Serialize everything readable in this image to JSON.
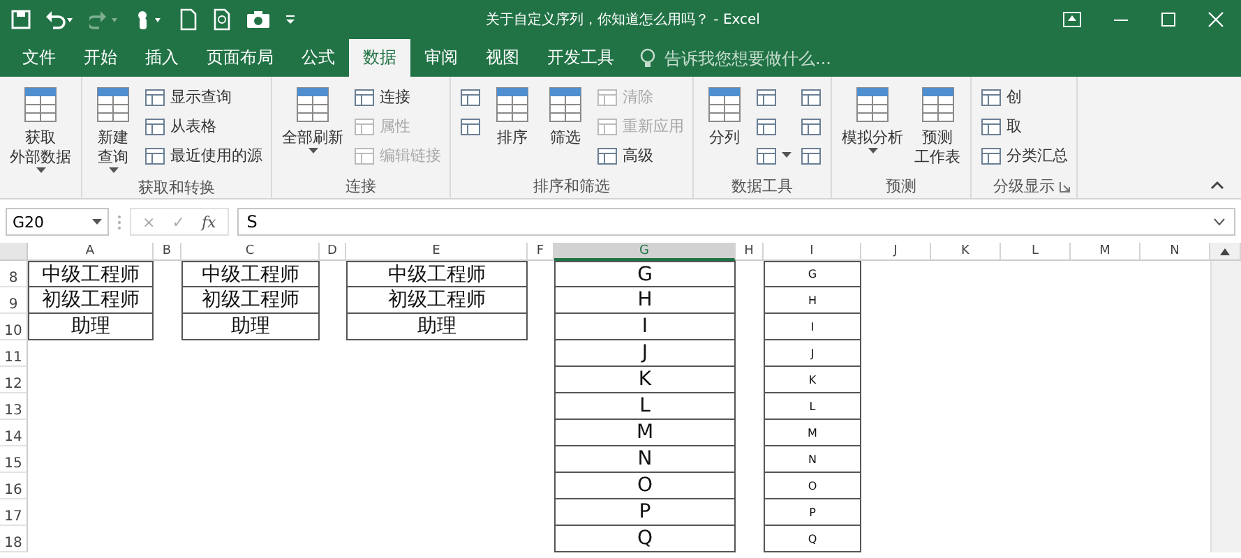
{
  "window": {
    "title": "关于自定义序列，你知道怎么用吗？ - Excel"
  },
  "tabs": [
    {
      "label": "文件",
      "selected": false
    },
    {
      "label": "开始",
      "selected": false
    },
    {
      "label": "插入",
      "selected": false
    },
    {
      "label": "页面布局",
      "selected": false
    },
    {
      "label": "公式",
      "selected": false
    },
    {
      "label": "数据",
      "selected": true
    },
    {
      "label": "审阅",
      "selected": false
    },
    {
      "label": "视图",
      "selected": false
    },
    {
      "label": "开发工具",
      "selected": false
    }
  ],
  "tell_me": {
    "placeholder": "告诉我您想要做什么..."
  },
  "ribbon": {
    "groups": [
      {
        "items": [
          {
            "kind": "large",
            "lines": [
              "获取",
              "外部数据"
            ],
            "dropdown": true
          }
        ]
      },
      {
        "label": "获取和转换",
        "items": [
          {
            "kind": "large",
            "lines": [
              "新建",
              "查询"
            ],
            "dropdown": true
          },
          {
            "kind": "small",
            "label": "显示查询",
            "disabled": false
          },
          {
            "kind": "small",
            "label": "从表格",
            "disabled": false
          },
          {
            "kind": "small",
            "label": "最近使用的源",
            "disabled": false
          }
        ]
      },
      {
        "label": "连接",
        "items": [
          {
            "kind": "large",
            "lines": [
              "全部刷新"
            ],
            "dropdown": true
          },
          {
            "kind": "small",
            "label": "连接",
            "disabled": false
          },
          {
            "kind": "small",
            "label": "属性",
            "disabled": true
          },
          {
            "kind": "small",
            "label": "编辑链接",
            "disabled": true
          }
        ]
      },
      {
        "label": "排序和筛选",
        "items": [
          {
            "kind": "icon"
          },
          {
            "kind": "icon"
          },
          {
            "kind": "large",
            "lines": [
              "排序"
            ]
          },
          {
            "kind": "large",
            "lines": [
              "筛选"
            ]
          },
          {
            "kind": "small",
            "label": "清除",
            "disabled": true
          },
          {
            "kind": "small",
            "label": "重新应用",
            "disabled": true
          },
          {
            "kind": "small",
            "label": "高级",
            "disabled": false
          }
        ]
      },
      {
        "label": "数据工具",
        "items": [
          {
            "kind": "large",
            "lines": [
              "分列"
            ]
          },
          {
            "kind": "icon"
          },
          {
            "kind": "icon"
          },
          {
            "kind": "icon",
            "dropdown": true
          },
          {
            "kind": "icon"
          },
          {
            "kind": "icon"
          },
          {
            "kind": "icon"
          }
        ]
      },
      {
        "label": "预测",
        "items": [
          {
            "kind": "large",
            "lines": [
              "模拟分析"
            ],
            "dropdown": true
          },
          {
            "kind": "large",
            "lines": [
              "预测",
              "工作表"
            ]
          }
        ]
      },
      {
        "label": "分级显示",
        "launcher": true,
        "items": [
          {
            "kind": "small",
            "label": "创",
            "disabled": false
          },
          {
            "kind": "small",
            "label": "取",
            "disabled": false
          },
          {
            "kind": "small",
            "label": "分类汇总",
            "disabled": false
          }
        ]
      }
    ]
  },
  "formula_bar": {
    "name_box": "G20",
    "buttons": [
      "×",
      "✓",
      "fx"
    ],
    "value": "S"
  },
  "sheet": {
    "row_numbers": [
      "8",
      "9",
      "10",
      "11",
      "12",
      "13",
      "14",
      "15",
      "16",
      "17",
      "18"
    ],
    "columns": [
      {
        "label": "A",
        "selected": false,
        "cells": [
          "中级工程师",
          "初级工程师",
          "助理"
        ]
      },
      {
        "label": "B",
        "selected": false
      },
      {
        "label": "C",
        "selected": false,
        "cells": [
          "中级工程师",
          "初级工程师",
          "助理"
        ]
      },
      {
        "label": "D",
        "selected": false
      },
      {
        "label": "E",
        "selected": false,
        "cells": [
          "中级工程师",
          "初级工程师",
          "助理"
        ]
      },
      {
        "label": "F",
        "selected": false
      },
      {
        "label": "G",
        "selected": true,
        "cells": [
          "G",
          "H",
          "I",
          "J",
          "K",
          "L",
          "M",
          "N",
          "O",
          "P",
          "Q"
        ]
      },
      {
        "label": "H",
        "selected": false
      },
      {
        "label": "I",
        "selected": false,
        "cells": [
          "G",
          "H",
          "I",
          "J",
          "K",
          "L",
          "M",
          "N",
          "O",
          "P",
          "Q"
        ]
      },
      {
        "label": "J",
        "selected": false
      },
      {
        "label": "K",
        "selected": false
      },
      {
        "label": "L",
        "selected": false
      },
      {
        "label": "M",
        "selected": false
      },
      {
        "label": "N",
        "selected": false
      }
    ]
  }
}
